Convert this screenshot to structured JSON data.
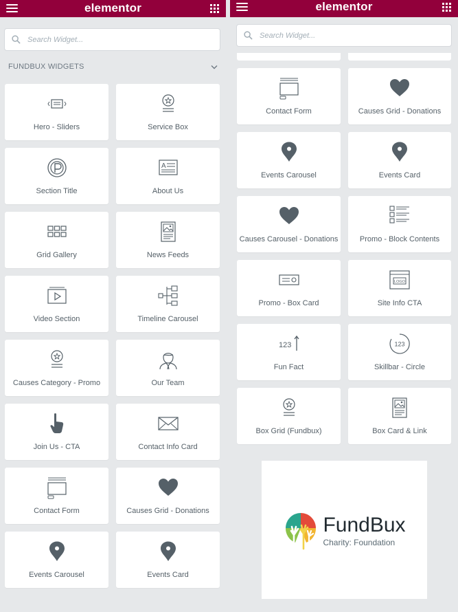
{
  "app": {
    "logo": "elementor",
    "header_color": "#92003b"
  },
  "search": {
    "placeholder": "Search Widget..."
  },
  "category": {
    "label": "FUNDBUX WIDGETS"
  },
  "left_widgets": [
    {
      "label": "Hero - Sliders",
      "icon": "slider-icon"
    },
    {
      "label": "Service Box",
      "icon": "badge-icon"
    },
    {
      "label": "Section Title",
      "icon": "title-icon"
    },
    {
      "label": "About Us",
      "icon": "text-block-icon"
    },
    {
      "label": "Grid Gallery",
      "icon": "gallery-icon"
    },
    {
      "label": "News Feeds",
      "icon": "image-card-icon"
    },
    {
      "label": "Video Section",
      "icon": "video-icon"
    },
    {
      "label": "Timeline Carousel",
      "icon": "timeline-icon"
    },
    {
      "label": "Causes Category - Promo",
      "icon": "badge-icon"
    },
    {
      "label": "Our Team",
      "icon": "person-icon"
    },
    {
      "label": "Join Us - CTA",
      "icon": "pointer-hand-icon"
    },
    {
      "label": "Contact Info Card",
      "icon": "envelope-icon"
    },
    {
      "label": "Contact Form",
      "icon": "form-icon"
    },
    {
      "label": "Causes Grid - Donations",
      "icon": "heart-icon"
    },
    {
      "label": "Events Carousel",
      "icon": "map-pin-icon"
    },
    {
      "label": "Events Card",
      "icon": "map-pin-icon"
    }
  ],
  "right_widgets": [
    {
      "label": "Contact Form",
      "icon": "form-icon"
    },
    {
      "label": "Causes Grid - Donations",
      "icon": "heart-icon"
    },
    {
      "label": "Events Carousel",
      "icon": "map-pin-icon"
    },
    {
      "label": "Events Card",
      "icon": "map-pin-icon"
    },
    {
      "label": "Causes Carousel - Donations",
      "icon": "heart-icon"
    },
    {
      "label": "Promo - Block Contents",
      "icon": "list-icon"
    },
    {
      "label": "Promo - Box Card",
      "icon": "box-card-icon"
    },
    {
      "label": "Site Info CTA",
      "icon": "logo-window-icon"
    },
    {
      "label": "Fun Fact",
      "icon": "counter-icon"
    },
    {
      "label": "Skillbar - Circle",
      "icon": "circle-counter-icon"
    },
    {
      "label": "Box Grid (Fundbux)",
      "icon": "badge-icon"
    },
    {
      "label": "Box Card & Link",
      "icon": "image-card-icon"
    }
  ],
  "counter_text": "123",
  "logo_window_text": "LOGO",
  "brand": {
    "name": "FundBux",
    "tagline": "Charity: Foundation"
  }
}
